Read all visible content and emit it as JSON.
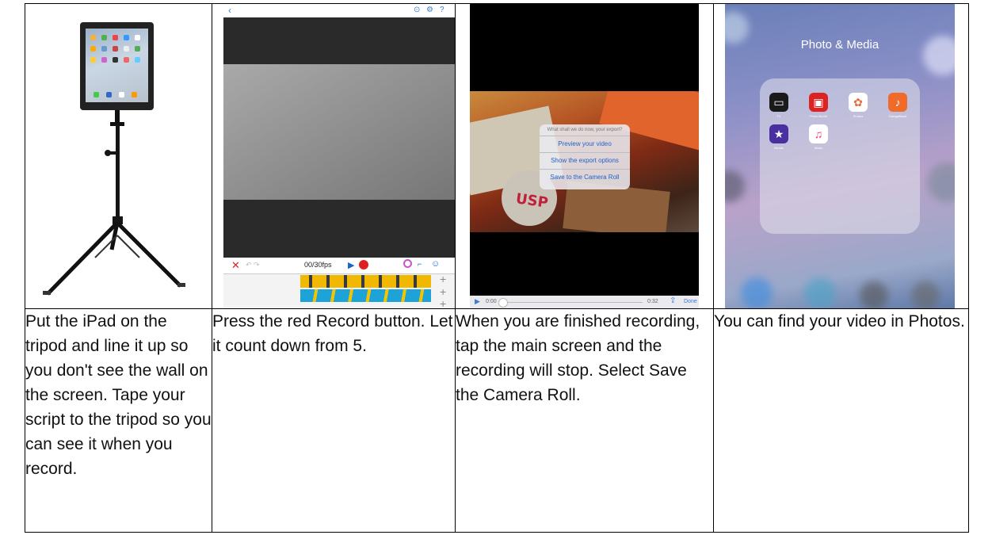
{
  "steps": [
    {
      "caption": "Put the iPad on the tripod and line it up so you don't see the wall on the screen. Tape your script to the tripod so you can see it when you record.",
      "image": "ipad-on-tripod"
    },
    {
      "caption": "Press the red Record button. Let it count down from 5.",
      "image": "video-record-app",
      "app": {
        "timer": "00/30fps",
        "share_icons": "share-icon"
      }
    },
    {
      "caption": "When you are finished recording, tap the main screen and the recording will stop. Select Save the Camera Roll.",
      "image": "export-menu",
      "menu": {
        "header": "What shall we do now, your export?",
        "items": [
          "Preview your video",
          "Show the export options",
          "Save to the Camera Roll"
        ]
      },
      "playbar": {
        "start": "0:00",
        "end": "0:32",
        "done": "Done"
      }
    },
    {
      "caption": "You can find your video in Photos.",
      "image": "photo-media-folder",
      "folder": {
        "title": "Photo & Media",
        "apps": [
          "TV",
          "Photo Booth",
          "Photos",
          "GarageBand",
          "iMovie",
          "Music"
        ]
      }
    }
  ],
  "colors": {
    "record": "#e02020",
    "accent": "#3a7bd5",
    "timeline_yellow": "#f0b800"
  }
}
